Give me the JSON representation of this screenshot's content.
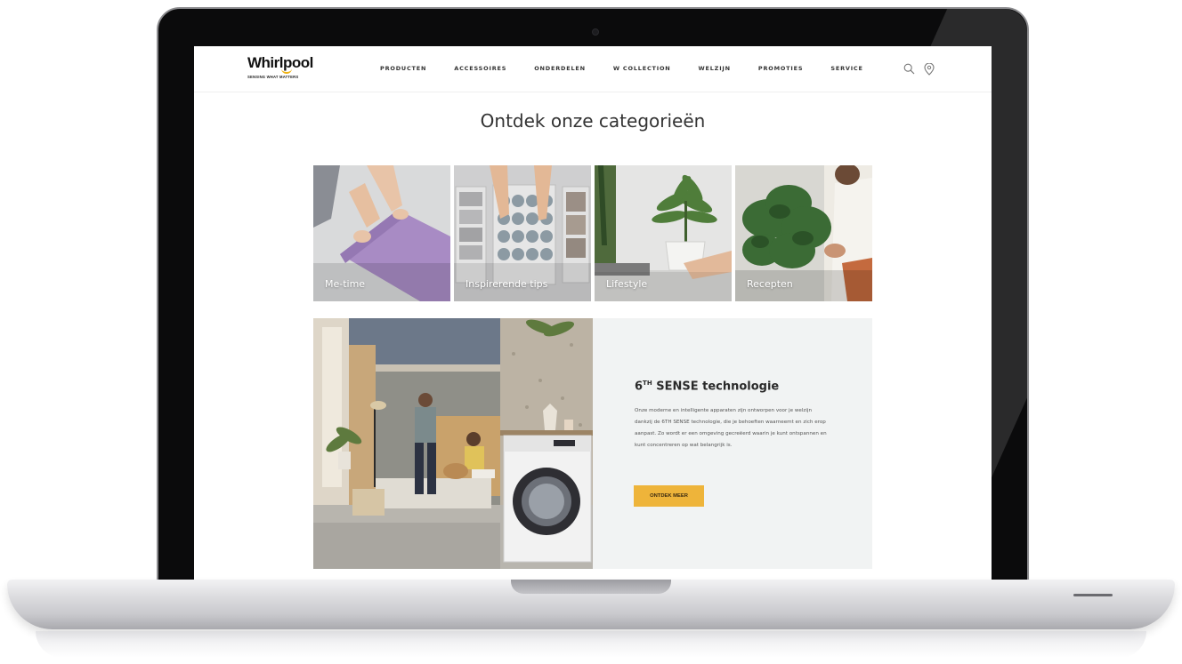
{
  "header": {
    "logo_text": "Whirlpool",
    "logo_tagline": "SENSING WHAT MATTERS",
    "nav": [
      {
        "label": "PRODUCTEN"
      },
      {
        "label": "ACCESSOIRES"
      },
      {
        "label": "ONDERDELEN"
      },
      {
        "label": "W COLLECTION"
      },
      {
        "label": "WELZIJN"
      },
      {
        "label": "PROMOTIES"
      },
      {
        "label": "SERVICE"
      }
    ],
    "icons": [
      "search-icon",
      "location-pin-icon"
    ]
  },
  "categories": {
    "title": "Ontdek onze categorieën",
    "tiles": [
      {
        "label": "Me-time"
      },
      {
        "label": "Inspirerende tips"
      },
      {
        "label": "Lifestyle"
      },
      {
        "label": "Recepten"
      }
    ]
  },
  "feature": {
    "title_prefix": "6",
    "title_sup": "TH",
    "title_suffix": " SENSE technologie",
    "body": "Onze moderne en intelligente apparaten zijn ontworpen voor je welzijn dankzij de 6TH SENSE technologie, die je behoeften waarneemt en zich erop aanpast. Zo wordt er een omgeving gecreëerd waarin je kunt ontspannen en kunt concentreren op wat belangrijk is.",
    "button_label": "ONTDEK MEER"
  },
  "colors": {
    "accent": "#eeb43a",
    "panel_bg": "#f1f3f3",
    "yoga_mat": "#a88bc4"
  }
}
